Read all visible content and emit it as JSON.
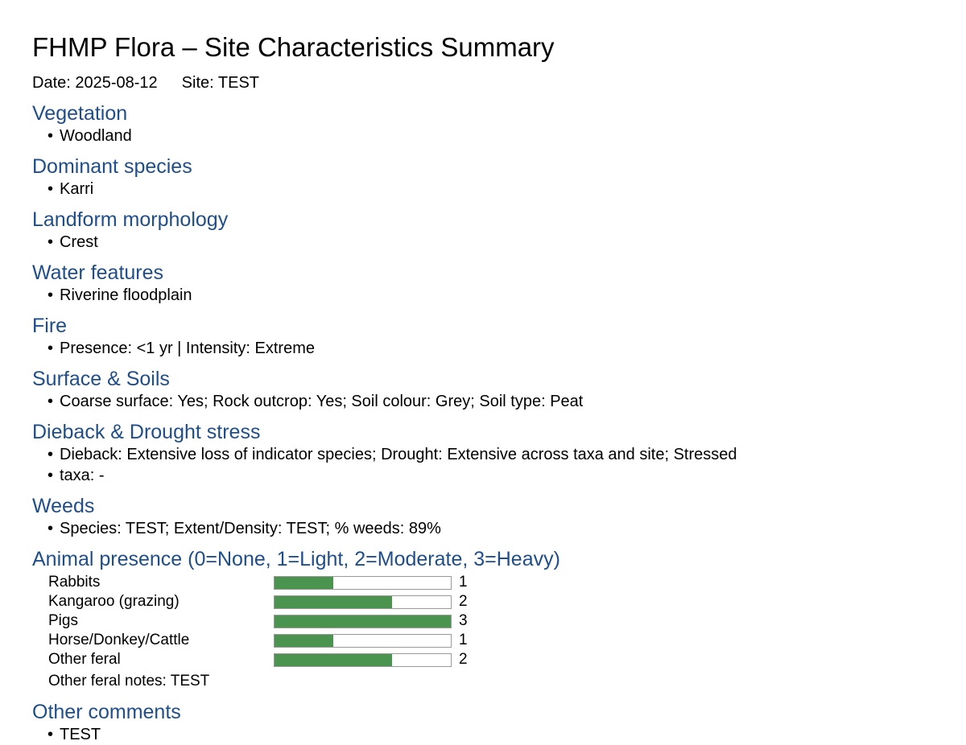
{
  "report": {
    "title": "FHMP Flora – Site Characteristics Summary",
    "date_text": "Date: 2025-08-12",
    "site_text": "Site: TEST"
  },
  "sections": {
    "vegetation": {
      "heading": "Vegetation",
      "items": [
        "Woodland"
      ]
    },
    "dominant_species": {
      "heading": "Dominant species",
      "items": [
        "Karri"
      ]
    },
    "landform": {
      "heading": "Landform morphology",
      "items": [
        "Crest"
      ]
    },
    "water": {
      "heading": "Water features",
      "items": [
        "Riverine floodplain"
      ]
    },
    "fire": {
      "heading": "Fire",
      "items": [
        "Presence: <1 yr | Intensity: Extreme"
      ]
    },
    "surface_soils": {
      "heading": "Surface & Soils",
      "items": [
        "Coarse surface: Yes; Rock outcrop: Yes; Soil colour: Grey; Soil type: Peat"
      ]
    },
    "dieback": {
      "heading": "Dieback & Drought stress",
      "items": [
        "Dieback: Extensive loss of indicator species; Drought: Extensive across taxa and site; Stressed",
        "taxa: -"
      ]
    },
    "weeds": {
      "heading": "Weeds",
      "items": [
        "Species: TEST; Extent/Density: TEST; % weeds: 89%"
      ]
    },
    "other_comments": {
      "heading": "Other comments",
      "items": [
        "TEST"
      ]
    }
  },
  "animals": {
    "heading": "Animal presence (0=None, 1=Light, 2=Moderate, 3=Heavy)",
    "scale_max": 3,
    "bar_color": "#4a944f",
    "rows": [
      {
        "label": "Rabbits",
        "value": 1
      },
      {
        "label": "Kangaroo (grazing)",
        "value": 2
      },
      {
        "label": "Pigs",
        "value": 3
      },
      {
        "label": "Horse/Donkey/Cattle",
        "value": 1
      },
      {
        "label": "Other feral",
        "value": 2
      }
    ],
    "notes": "Other feral notes: TEST"
  }
}
